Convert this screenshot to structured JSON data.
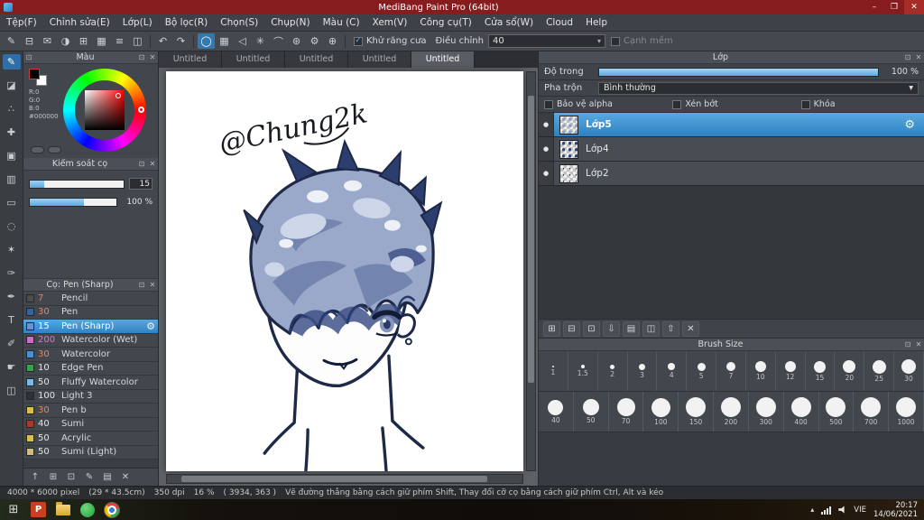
{
  "ui": {
    "check_glyph": "✓",
    "caret_glyph": "▾",
    "detach_glyph": "⊡",
    "close_glyph": "✕",
    "eye_dot": "●",
    "gear_glyph": "⚙"
  },
  "window": {
    "title": "MediBang Paint Pro (64bit)",
    "minimize": "–",
    "maximize": "❐",
    "close": "✕"
  },
  "menu": {
    "items": [
      "Tệp(F)",
      "Chỉnh sửa(E)",
      "Lớp(L)",
      "Bộ lọc(R)",
      "Chọn(S)",
      "Chụp(N)",
      "Màu (C)",
      "Xem(V)",
      "Công cụ(T)",
      "Cửa sổ(W)",
      "Cloud",
      "Help"
    ]
  },
  "toolbar": {
    "left_icons": [
      {
        "name": "brush-icon",
        "glyph": "✎"
      },
      {
        "name": "save-icon",
        "glyph": "⊟"
      },
      {
        "name": "message-icon",
        "glyph": "✉"
      },
      {
        "name": "palette-icon",
        "glyph": "◑"
      },
      {
        "name": "grid-icon",
        "glyph": "⊞"
      },
      {
        "name": "table-icon",
        "glyph": "▦"
      },
      {
        "name": "list-icon",
        "glyph": "≡"
      },
      {
        "name": "panels-icon",
        "glyph": "◫"
      }
    ],
    "undo_glyph": "↶",
    "redo_glyph": "↷",
    "mid_icons": [
      {
        "name": "brush-shape-icon",
        "glyph": "◯"
      },
      {
        "name": "pixel-grid-icon",
        "glyph": "▦"
      },
      {
        "name": "snap-off-icon",
        "glyph": "◁"
      },
      {
        "name": "snap-cross-icon",
        "glyph": "✳"
      },
      {
        "name": "snap-curve-icon",
        "glyph": "⌒"
      },
      {
        "name": "snap-radial-icon",
        "glyph": "⊛"
      },
      {
        "name": "snap-settings-icon",
        "glyph": "⚙"
      },
      {
        "name": "snap-target-icon",
        "glyph": "⊕"
      }
    ],
    "antialias_label": "Khử răng cưa",
    "adjust_label": "Điều chỉnh",
    "adjust_value": "40",
    "soft_edge_label": "Cạnh mềm"
  },
  "tools": {
    "items": [
      {
        "name": "brush-tool",
        "glyph": "✎"
      },
      {
        "name": "eraser-tool",
        "glyph": "◪"
      },
      {
        "name": "dot-tool",
        "glyph": "∴"
      },
      {
        "name": "move-tool",
        "glyph": "✚"
      },
      {
        "name": "fill-tool",
        "glyph": "▣"
      },
      {
        "name": "gradient-tool",
        "glyph": "▥"
      },
      {
        "name": "select-tool",
        "glyph": "▭"
      },
      {
        "name": "lasso-tool",
        "glyph": "◌"
      },
      {
        "name": "magic-wand-tool",
        "glyph": "✶"
      },
      {
        "name": "select-pen-tool",
        "glyph": "✑"
      },
      {
        "name": "select-eraser-tool",
        "glyph": "✒"
      },
      {
        "name": "text-tool",
        "glyph": "T"
      },
      {
        "name": "eyedropper-tool",
        "glyph": "✐"
      },
      {
        "name": "hand-tool",
        "glyph": "☛"
      },
      {
        "name": "divide-tool",
        "glyph": "◫"
      }
    ]
  },
  "color_panel": {
    "title": "Màu",
    "r": "R:0",
    "g": "G:0",
    "b": "B:0",
    "hex": "#000000"
  },
  "brush_control": {
    "title": "Kiểm soát cọ",
    "size_value": "15",
    "opacity_value": "100 %"
  },
  "brush_panel": {
    "title": "Cọ: Pen (Sharp)",
    "brushes": [
      {
        "size": "7",
        "name": "Pencil",
        "swatch": "#4c4c4c",
        "num_color": "#e2876a"
      },
      {
        "size": "30",
        "name": "Pen",
        "swatch": "#38629e",
        "num_color": "#e2876a"
      },
      {
        "size": "15",
        "name": "Pen (Sharp)",
        "swatch": "#6a93cf",
        "num_color": "#ffffff"
      },
      {
        "size": "200",
        "name": "Watercolor (Wet)",
        "swatch": "#c86ec8",
        "num_color": "#de74d4"
      },
      {
        "size": "30",
        "name": "Watercolor",
        "swatch": "#4a90d9",
        "num_color": "#e2876a"
      },
      {
        "size": "10",
        "name": "Edge Pen",
        "swatch": "#3aa24a",
        "num_color": "#e6e6e6"
      },
      {
        "size": "50",
        "name": "Fluffy Watercolor",
        "swatch": "#7ab8e8",
        "num_color": "#e6e6e6"
      },
      {
        "size": "100",
        "name": "Light 3",
        "swatch": "#2e3138",
        "num_color": "#e6e6e6"
      },
      {
        "size": "30",
        "name": "Pen b",
        "swatch": "#d8c04a",
        "num_color": "#e2876a"
      },
      {
        "size": "40",
        "name": "Sumi",
        "swatch": "#a8392a",
        "num_color": "#e6e6e6"
      },
      {
        "size": "50",
        "name": "Acrylic",
        "swatch": "#d8c04a",
        "num_color": "#e6e6e6"
      },
      {
        "size": "50",
        "name": "Sumi (Light)",
        "swatch": "#cdbd7d",
        "num_color": "#e6e6e6"
      }
    ],
    "footer_icons": [
      {
        "name": "upload-brush-icon",
        "glyph": "↑"
      },
      {
        "name": "new-brush-icon",
        "glyph": "⊞"
      },
      {
        "name": "duplicate-brush-icon",
        "glyph": "⊡"
      },
      {
        "name": "edit-brush-icon",
        "glyph": "✎"
      },
      {
        "name": "brush-folder-icon",
        "glyph": "▤"
      },
      {
        "name": "delete-brush-icon",
        "glyph": "✕"
      }
    ]
  },
  "tabs": {
    "items": [
      "Untitled",
      "Untitled",
      "Untitled",
      "Untitled",
      "Untitled"
    ]
  },
  "canvas": {
    "signature": "@Chung2k"
  },
  "layer_panel": {
    "title": "Lớp",
    "opacity_label": "Độ trong",
    "opacity_value": "100 %",
    "blend_label": "Pha trộn",
    "blend_value": "Bình thường",
    "alpha_label": "Bảo vệ alpha",
    "clip_label": "Xén bớt",
    "lock_label": "Khóa",
    "layers": [
      {
        "name": "Lớp5"
      },
      {
        "name": "Lớp4"
      },
      {
        "name": "Lớp2"
      }
    ],
    "action_icons": [
      {
        "name": "new-layer-icon",
        "glyph": "⊞"
      },
      {
        "name": "new-folder-layer-icon",
        "glyph": "⊟"
      },
      {
        "name": "duplicate-layer-icon",
        "glyph": "⊡"
      },
      {
        "name": "merge-down-icon",
        "glyph": "⇩"
      },
      {
        "name": "layer-folder-icon",
        "glyph": "▤"
      },
      {
        "name": "copy-layer-icon",
        "glyph": "◫"
      },
      {
        "name": "transfer-layer-icon",
        "glyph": "⇧"
      },
      {
        "name": "delete-layer-icon",
        "glyph": "✕"
      }
    ]
  },
  "brush_size_panel": {
    "title": "Brush Size",
    "sizes": [
      "1",
      "1.5",
      "2",
      "3",
      "4",
      "5",
      "7",
      "10",
      "12",
      "15",
      "20",
      "25",
      "30",
      "40",
      "50",
      "70",
      "100",
      "150",
      "200",
      "300",
      "400",
      "500",
      "700",
      "1000"
    ]
  },
  "status_bar": {
    "dimensions": "4000 * 6000 pixel",
    "size_cm": "(29 * 43.5cm)",
    "dpi": "350 dpi",
    "zoom": "16 %",
    "coords": "( 3934, 363 )",
    "hint": "Vẽ đường thẳng bằng cách giữ phím Shift, Thay đổi cỡ cọ bằng cách giữ phím Ctrl, Alt và kéo"
  },
  "taskbar": {
    "start_glyph": "⊞",
    "powerpoint_letter": "P",
    "language": "VIE",
    "time": "20:17",
    "date": "14/06/2021"
  },
  "colors": {
    "accent": "#4aa0dc",
    "titlebar": "#871c1f",
    "selected_top": "#58a8e0",
    "selected_bottom": "#2f83c2"
  }
}
